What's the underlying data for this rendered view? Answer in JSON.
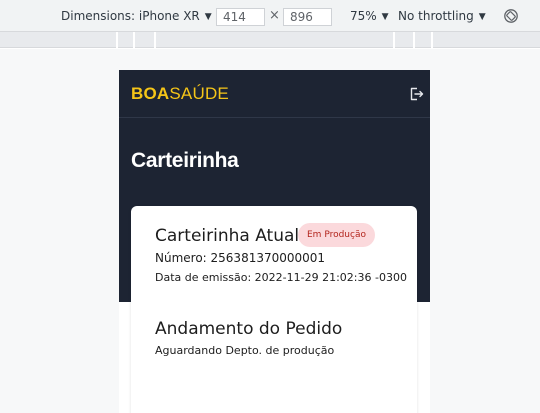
{
  "devtools": {
    "device_label": "Dimensions: iPhone XR",
    "width_value": "414",
    "height_value": "896",
    "times": "×",
    "zoom_label": "75%",
    "throttle_label": "No throttling",
    "caret": "▼"
  },
  "app": {
    "brand_bold": "BOA",
    "brand_light": "SAÚDE",
    "brand_color": "#f5c518",
    "nav_bg": "#1d2433",
    "logout_icon": "logout-icon"
  },
  "page": {
    "title": "Carteirinha"
  },
  "card": {
    "title": "Carteirinha Atual",
    "badge": "Em Produção",
    "number_line": "Número: 256381370000001",
    "issue_line": "Data de emissão: 2022-11-29 21:02:36 -0300",
    "order_title": "Andamento do Pedido",
    "order_status": "Aguardando Depto. de produção"
  }
}
